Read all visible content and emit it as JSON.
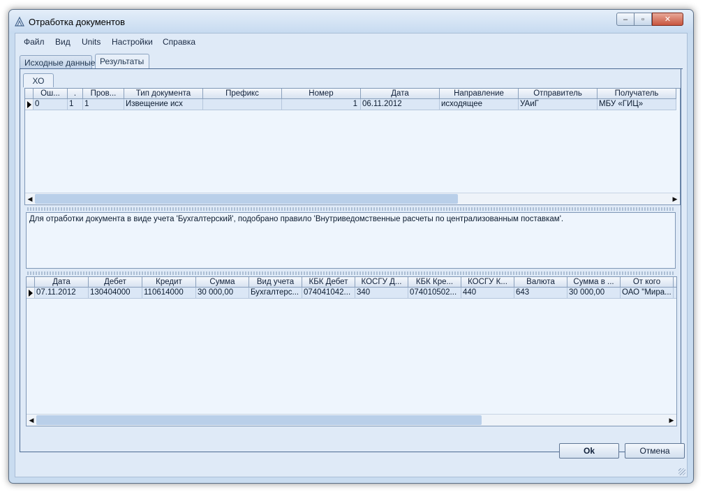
{
  "window": {
    "title": "Отработка документов",
    "minimize": "–",
    "maximize": "▫",
    "close": "✕"
  },
  "menu": [
    "Файл",
    "Вид",
    "Units",
    "Настройки",
    "Справка"
  ],
  "tabs": [
    "Исходные данные",
    "Результаты"
  ],
  "subtab": "ХО",
  "docs_grid": {
    "headers": [
      "Ош...",
      ".",
      "Пров...",
      "Тип документа",
      "Префикс",
      "Номер",
      "Дата",
      "Направление",
      "Отправитель",
      "Получатель"
    ],
    "rows": [
      [
        "0",
        "1",
        "1",
        "Извещение исх",
        "",
        "1",
        "06.11.2012",
        "исходящее",
        "УАиГ",
        "МБУ «ГИЦ»"
      ]
    ]
  },
  "message": "Для отработки документа в виде учета 'Бухгалтерский', подобрано правило 'Внутриведомственные расчеты по централизованным поставкам'.",
  "entries_grid": {
    "headers": [
      "Дата",
      "Дебет",
      "Кредит",
      "Сумма",
      "Вид учета",
      "КБК Дебет",
      "КОСГУ Д...",
      "КБК Кре...",
      "КОСГУ К...",
      "Валюта",
      "Сумма в ...",
      "От кого"
    ],
    "rows": [
      [
        "07.11.2012",
        "130404000",
        "110614000",
        "30 000,00",
        "Бухгалтерс...",
        "074041042...",
        "340",
        "074010502...",
        "440",
        "643",
        "30 000,00",
        "ОАО \"Мира..."
      ]
    ]
  },
  "buttons": {
    "ok": "Ok",
    "cancel": "Отмена"
  },
  "colors": {
    "window_bg": "#c9dcf0",
    "grid_bg": "#eef5fd",
    "selected_row": "#dbe7f6",
    "frame": "#4c6a93"
  }
}
